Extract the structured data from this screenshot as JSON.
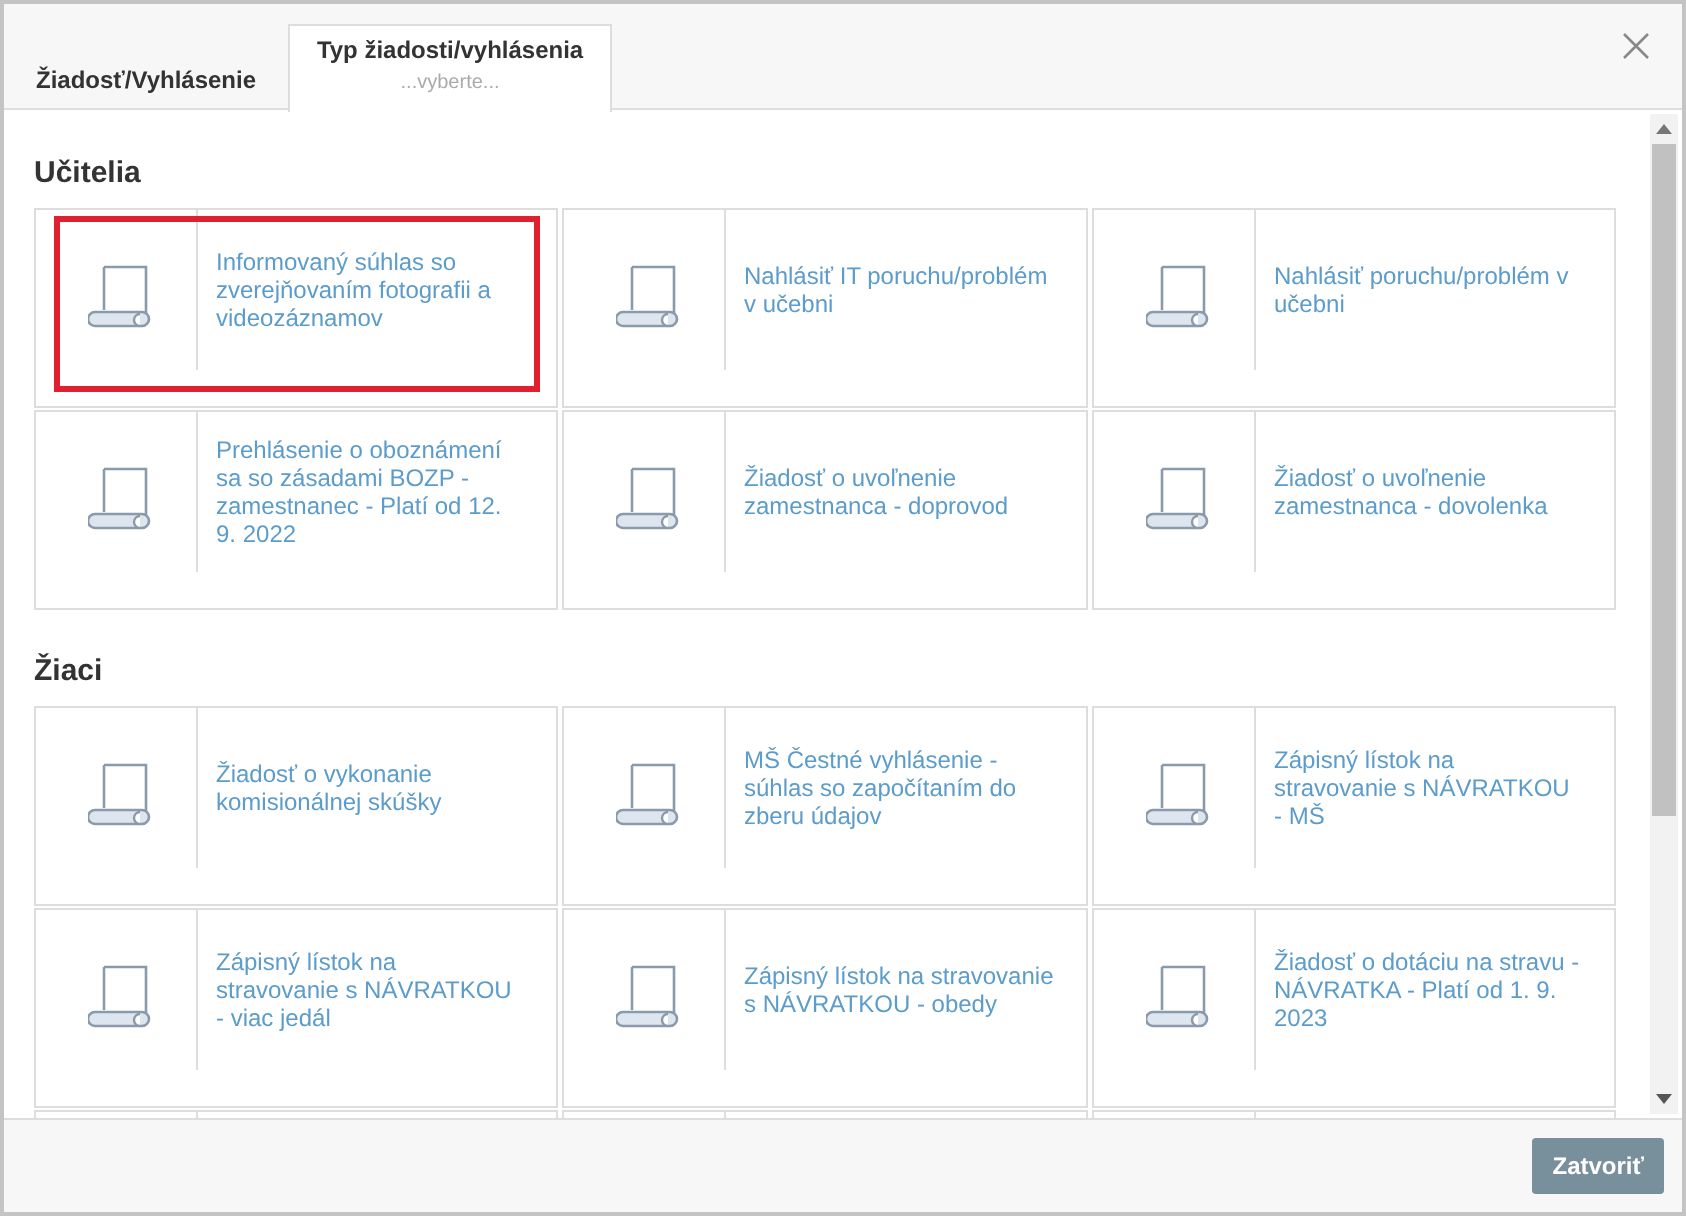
{
  "tabs": [
    {
      "label": "Žiadosť/Vyhlásenie",
      "selected": false
    },
    {
      "label": "Typ žiadosti/vyhlásenia",
      "sublabel": "...vyberte...",
      "selected": true
    }
  ],
  "sections": [
    {
      "title": "Učitelia",
      "items": [
        {
          "kind": "form",
          "title": "Informovaný súhlas so zverejňovaním fotografii a videozáznamov",
          "highlighted": true
        },
        {
          "kind": "form",
          "title": "Nahlásiť IT poruchu/problém v učebni",
          "highlighted": false
        },
        {
          "kind": "form",
          "title": "Nahlásiť poruchu/problém v učebni",
          "highlighted": false
        },
        {
          "kind": "form",
          "title": "Prehlásenie o oboznámení sa so zásadami BOZP - zamestnanec - Platí od 12. 9. 2022",
          "highlighted": false
        },
        {
          "kind": "form",
          "title": "Žiadosť o uvoľnenie zamestnanca - doprovod",
          "highlighted": false
        },
        {
          "kind": "form",
          "title": "Žiadosť o uvoľnenie zamestnanca - dovolenka",
          "highlighted": false
        }
      ]
    },
    {
      "title": "Žiaci",
      "items": [
        {
          "kind": "form",
          "title": "Žiadosť o vykonanie komisionálnej skúšky",
          "highlighted": false
        },
        {
          "kind": "form",
          "title": "MŠ Čestné vyhlásenie - súhlas so započítaním do zberu údajov",
          "highlighted": false
        },
        {
          "kind": "form",
          "title": "Zápisný lístok na stravovanie s NÁVRATKOU - MŠ",
          "highlighted": false
        },
        {
          "kind": "form",
          "title": "Zápisný lístok na stravovanie s NÁVRATKOU - viac jedál",
          "highlighted": false
        },
        {
          "kind": "form",
          "title": "Zápisný lístok na stravovanie s NÁVRATKOU - obedy",
          "highlighted": false
        },
        {
          "kind": "form",
          "title": "Žiadosť o dotáciu na stravu - NÁVRATKA - Platí od 1. 9. 2023",
          "highlighted": false
        },
        {
          "kind": "empty"
        },
        {
          "kind": "empty"
        },
        {
          "kind": "empty"
        }
      ]
    }
  ],
  "close_button": "Zatvoriť"
}
